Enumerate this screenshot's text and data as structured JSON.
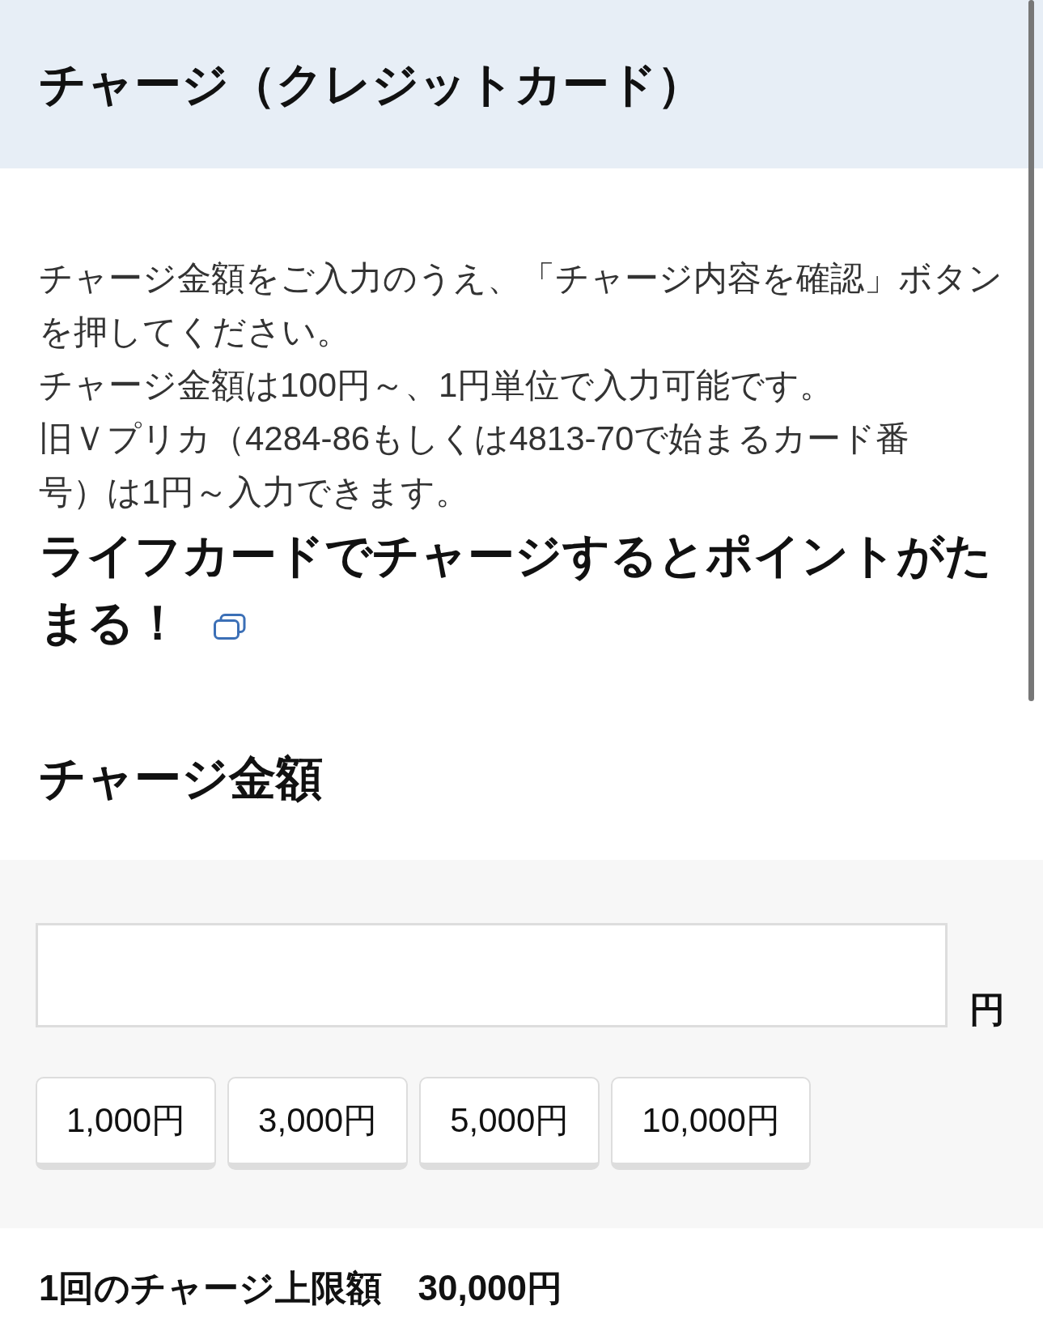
{
  "header": {
    "title": "チャージ（クレジットカード）"
  },
  "instructions": {
    "lines": [
      "チャージ金額をご入力のうえ、「チャージ内容を確認」ボタン",
      "を押してください。",
      "チャージ金額は100円～、1円単位で入力可能です。",
      "旧Ｖプリカ（4284-86もしくは4813-70で始まるカード番",
      "号）は1円～入力できます。"
    ]
  },
  "promo_link": {
    "lines": [
      "ライフカードでチャージするとポイントがた",
      "まる！"
    ]
  },
  "amount_section": {
    "title": "チャージ金額",
    "unit": "円",
    "presets": [
      {
        "label": "1,000円"
      },
      {
        "label": "3,000円"
      },
      {
        "label": "5,000円"
      },
      {
        "label": "10,000円"
      }
    ]
  },
  "limit": {
    "label": "1回のチャージ上限額",
    "value": "30,000円"
  }
}
